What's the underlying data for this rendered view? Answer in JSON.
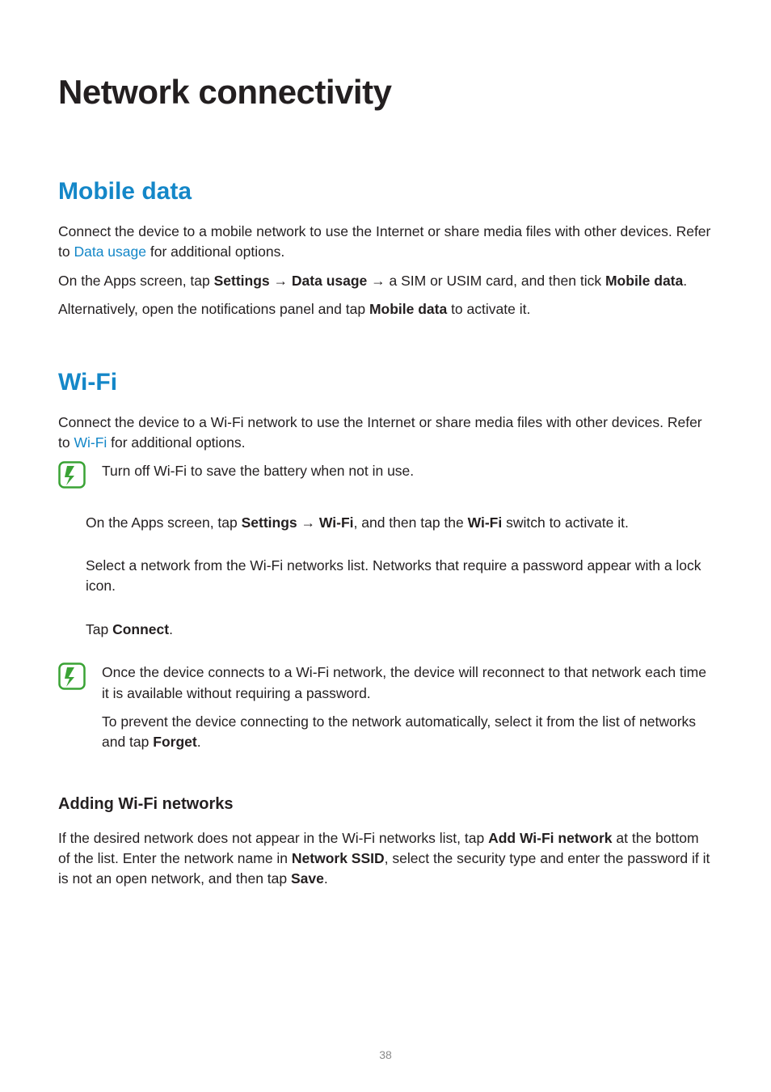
{
  "page_number": "38",
  "title": "Network connectivity",
  "mobile": {
    "heading": "Mobile data",
    "p1a": "Connect the device to a mobile network to use the Internet or share media files with other devices. Refer to ",
    "p1link": "Data usage",
    "p1b": " for additional options.",
    "p2a": "On the Apps screen, tap ",
    "p2_settings": "Settings",
    "arrow": " → ",
    "p2_du": "Data usage",
    "p2b": " → a SIM or USIM card, and then tick ",
    "p2_md": "Mobile data",
    "period": ".",
    "p3a": "Alternatively, open the notifications panel and tap ",
    "p3_md": "Mobile data",
    "p3b": " to activate it."
  },
  "wifi": {
    "heading": "Wi-Fi",
    "p1a": "Connect the device to a Wi-Fi network to use the Internet or share media files with other devices. Refer to ",
    "p1link": "Wi-Fi",
    "p1b": " for additional options.",
    "note1": "Turn off Wi-Fi to save the battery when not in use.",
    "s1a": "On the Apps screen, tap ",
    "s1_settings": "Settings",
    "s1_arrow": " → ",
    "s1_wifi": "Wi-Fi",
    "s1b": ", and then tap the ",
    "s1_wifi2": "Wi-Fi",
    "s1c": " switch to activate it.",
    "s2": "Select a network from the Wi-Fi networks list. Networks that require a password appear with a lock icon.",
    "s3a": "Tap ",
    "s3_connect": "Connect",
    "s3b": ".",
    "note2a": "Once the device connects to a Wi-Fi network, the device will reconnect to that network each time it is available without requiring a password.",
    "note2b_a": "To prevent the device connecting to the network automatically, select it from the list of networks and tap ",
    "note2b_forget": "Forget",
    "note2b_b": ".",
    "add_heading": "Adding Wi-Fi networks",
    "add_a": "If the desired network does not appear in the Wi-Fi networks list, tap ",
    "add_awn": "Add Wi-Fi network",
    "add_b": " at the bottom of the list. Enter the network name in ",
    "add_ssid": "Network SSID",
    "add_c": ", select the security type and enter the password if it is not an open network, and then tap ",
    "add_save": "Save",
    "add_d": "."
  }
}
